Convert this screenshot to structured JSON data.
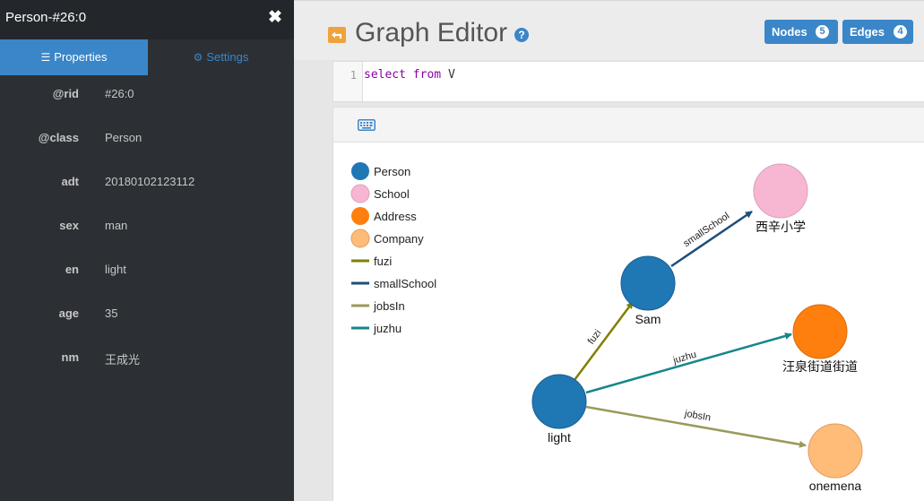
{
  "panel": {
    "title": "Person-#26:0",
    "close_icon": "close-icon",
    "tabs": [
      {
        "label": "Properties",
        "icon": "list-icon"
      },
      {
        "label": "Settings",
        "icon": "gear-icon"
      }
    ],
    "properties": [
      {
        "key": "@rid",
        "value": "#26:0"
      },
      {
        "key": "@class",
        "value": "Person"
      },
      {
        "key": "adt",
        "value": "20180102123112"
      },
      {
        "key": "sex",
        "value": "man"
      },
      {
        "key": "en",
        "value": "light"
      },
      {
        "key": "age",
        "value": "35"
      },
      {
        "key": "nm",
        "value": "王成光"
      }
    ]
  },
  "header": {
    "title": "Graph Editor",
    "back_icon": "back-arrow-icon",
    "help_icon": "help-icon",
    "nodes_label": "Nodes",
    "nodes_count": "5",
    "edges_label": "Edges",
    "edges_count": "4"
  },
  "editor": {
    "line_number": "1",
    "query_kw1": "select",
    "query_kw2": "from",
    "query_rest": "V"
  },
  "toolbar": {
    "keyboard_icon": "keyboard-icon"
  },
  "legend": [
    {
      "label": "Person",
      "kind": "node",
      "color": "#1f77b4"
    },
    {
      "label": "School",
      "kind": "node",
      "color": "#f7b6d2"
    },
    {
      "label": "Address",
      "kind": "node",
      "color": "#ff7f0e"
    },
    {
      "label": "Company",
      "kind": "node",
      "color": "#ffbb78"
    },
    {
      "label": "fuzi",
      "kind": "edge",
      "color": "#808000"
    },
    {
      "label": "smallSchool",
      "kind": "edge",
      "color": "#1f4e79"
    },
    {
      "label": "jobsIn",
      "kind": "edge",
      "color": "#9a9a5a"
    },
    {
      "label": "juzhu",
      "kind": "edge",
      "color": "#17868a"
    }
  ],
  "graph": {
    "nodes": [
      {
        "id": "light",
        "label": "light",
        "class": "Person"
      },
      {
        "id": "sam",
        "label": "Sam",
        "class": "Person"
      },
      {
        "id": "school",
        "label": "西辛小学",
        "class": "School"
      },
      {
        "id": "address",
        "label": "汪泉街道街道",
        "class": "Address"
      },
      {
        "id": "company",
        "label": "onemena",
        "class": "Company"
      }
    ],
    "edges": [
      {
        "from": "light",
        "to": "sam",
        "label": "fuzi"
      },
      {
        "from": "sam",
        "to": "school",
        "label": "smallSchool"
      },
      {
        "from": "light",
        "to": "address",
        "label": "juzhu"
      },
      {
        "from": "light",
        "to": "company",
        "label": "jobsIn"
      }
    ]
  }
}
